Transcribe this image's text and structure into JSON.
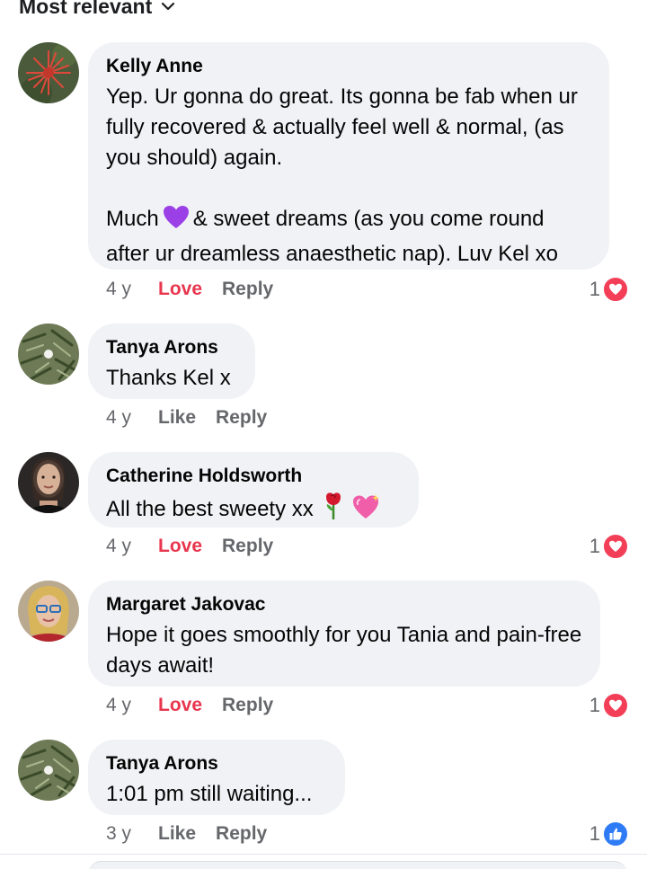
{
  "sort": {
    "label": "Most relevant",
    "icon": "chevron-down-icon"
  },
  "comments": [
    {
      "author": "Kelly Anne",
      "lines": [
        "Yep. Ur gonna do great. Its gonna be fab when ur fully recovered & actually feel well & normal, (as you should) again."
      ],
      "line2_before": "Much",
      "line2_after": "& sweet dreams (as you come round after ur dreamless anaesthetic nap). Luv Kel xo",
      "time": "4 y",
      "primary_action": "Love",
      "reply": "Reply",
      "reaction_count": "1",
      "reaction_icon": "heart-reaction-icon"
    },
    {
      "author": "Tanya Arons",
      "text": "Thanks Kel x",
      "time": "4 y",
      "primary_action": "Like",
      "reply": "Reply"
    },
    {
      "author": "Catherine Holdsworth",
      "text": "All the best sweety xx",
      "time": "4 y",
      "primary_action": "Love",
      "reply": "Reply",
      "reaction_count": "1",
      "reaction_icon": "heart-reaction-icon"
    },
    {
      "author": "Margaret Jakovac",
      "text": "Hope it goes smoothly for you Tania and pain-free days await!",
      "time": "4 y",
      "primary_action": "Love",
      "reply": "Reply",
      "reaction_count": "1",
      "reaction_icon": "heart-reaction-icon"
    },
    {
      "author": "Tanya Arons",
      "text": "1:01 pm still waiting...",
      "time": "3 y",
      "primary_action": "Like",
      "reply": "Reply",
      "reaction_count": "1",
      "reaction_icon": "like-reaction-icon"
    }
  ],
  "colors": {
    "love": "#e8364e",
    "heart": "#f33e58",
    "like": "#2e7bf5",
    "muted": "#65676b",
    "bubble": "#f0f2f5"
  }
}
